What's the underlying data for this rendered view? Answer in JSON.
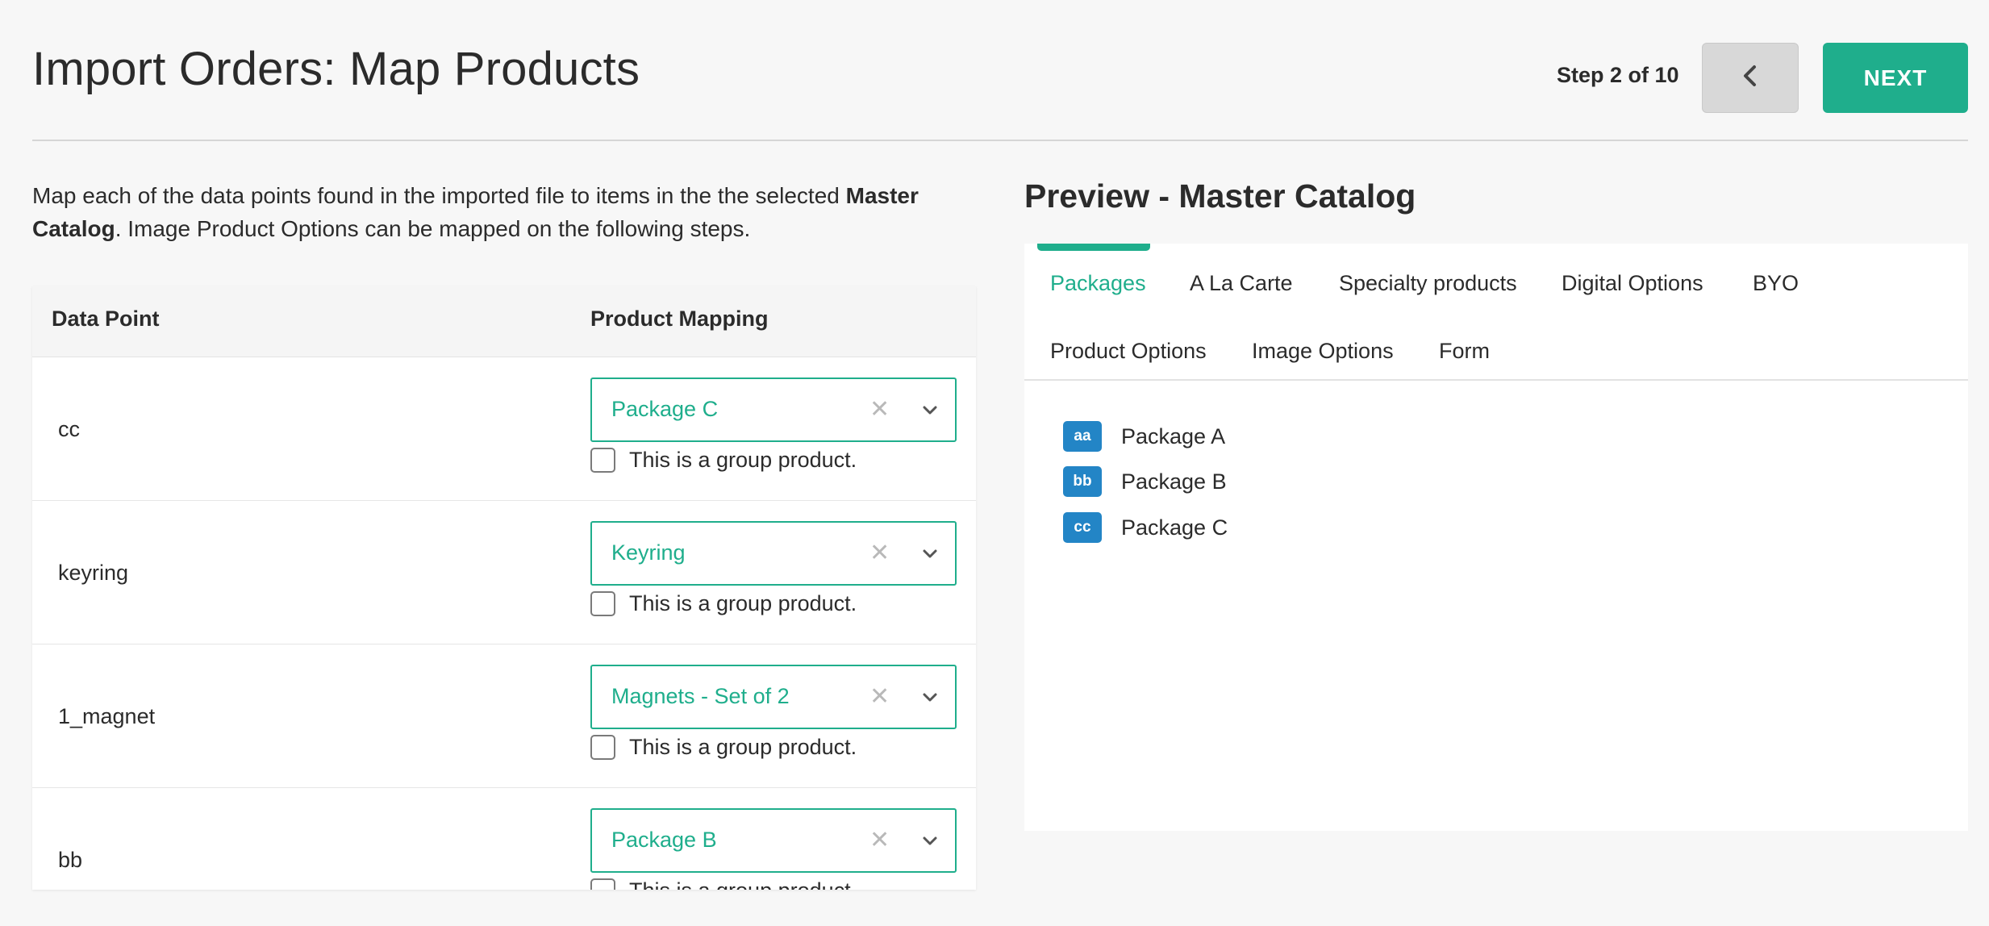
{
  "header": {
    "title": "Import Orders: Map Products",
    "step": "Step 2 of 10",
    "back_icon": "chevron-left-icon",
    "next_label": "NEXT",
    "accent_color": "#1fae8c"
  },
  "intro": {
    "text_before": "Map each of the data points found in the imported file to items in the the selected ",
    "bold": "Master Catalog",
    "text_after": ". Image Product Options can be mapped on the following steps."
  },
  "mapping_table": {
    "headers": {
      "data_point": "Data Point",
      "product_mapping": "Product Mapping"
    },
    "clear_glyph": "✕",
    "rows": [
      {
        "data_point": "cc",
        "product": "Package C",
        "group_label": "This is a group product."
      },
      {
        "data_point": "keyring",
        "product": "Keyring",
        "group_label": "This is a group product."
      },
      {
        "data_point": "1_magnet",
        "product": "Magnets - Set of 2",
        "group_label": "This is a group product."
      },
      {
        "data_point": "bb",
        "product": "Package B",
        "group_label": "This is a group product."
      }
    ]
  },
  "preview": {
    "title": "Preview - Master Catalog",
    "tabs": [
      {
        "label": "Packages",
        "active": true
      },
      {
        "label": "A La Carte"
      },
      {
        "label": "Specialty products"
      },
      {
        "label": "Digital Options"
      },
      {
        "label": "BYO"
      },
      {
        "label": "Product Options"
      },
      {
        "label": "Image Options"
      },
      {
        "label": "Form"
      }
    ],
    "badge_color": "#2385c6",
    "packages": [
      {
        "code": "aa",
        "name": "Package A"
      },
      {
        "code": "bb",
        "name": "Package B"
      },
      {
        "code": "cc",
        "name": "Package C"
      }
    ]
  }
}
